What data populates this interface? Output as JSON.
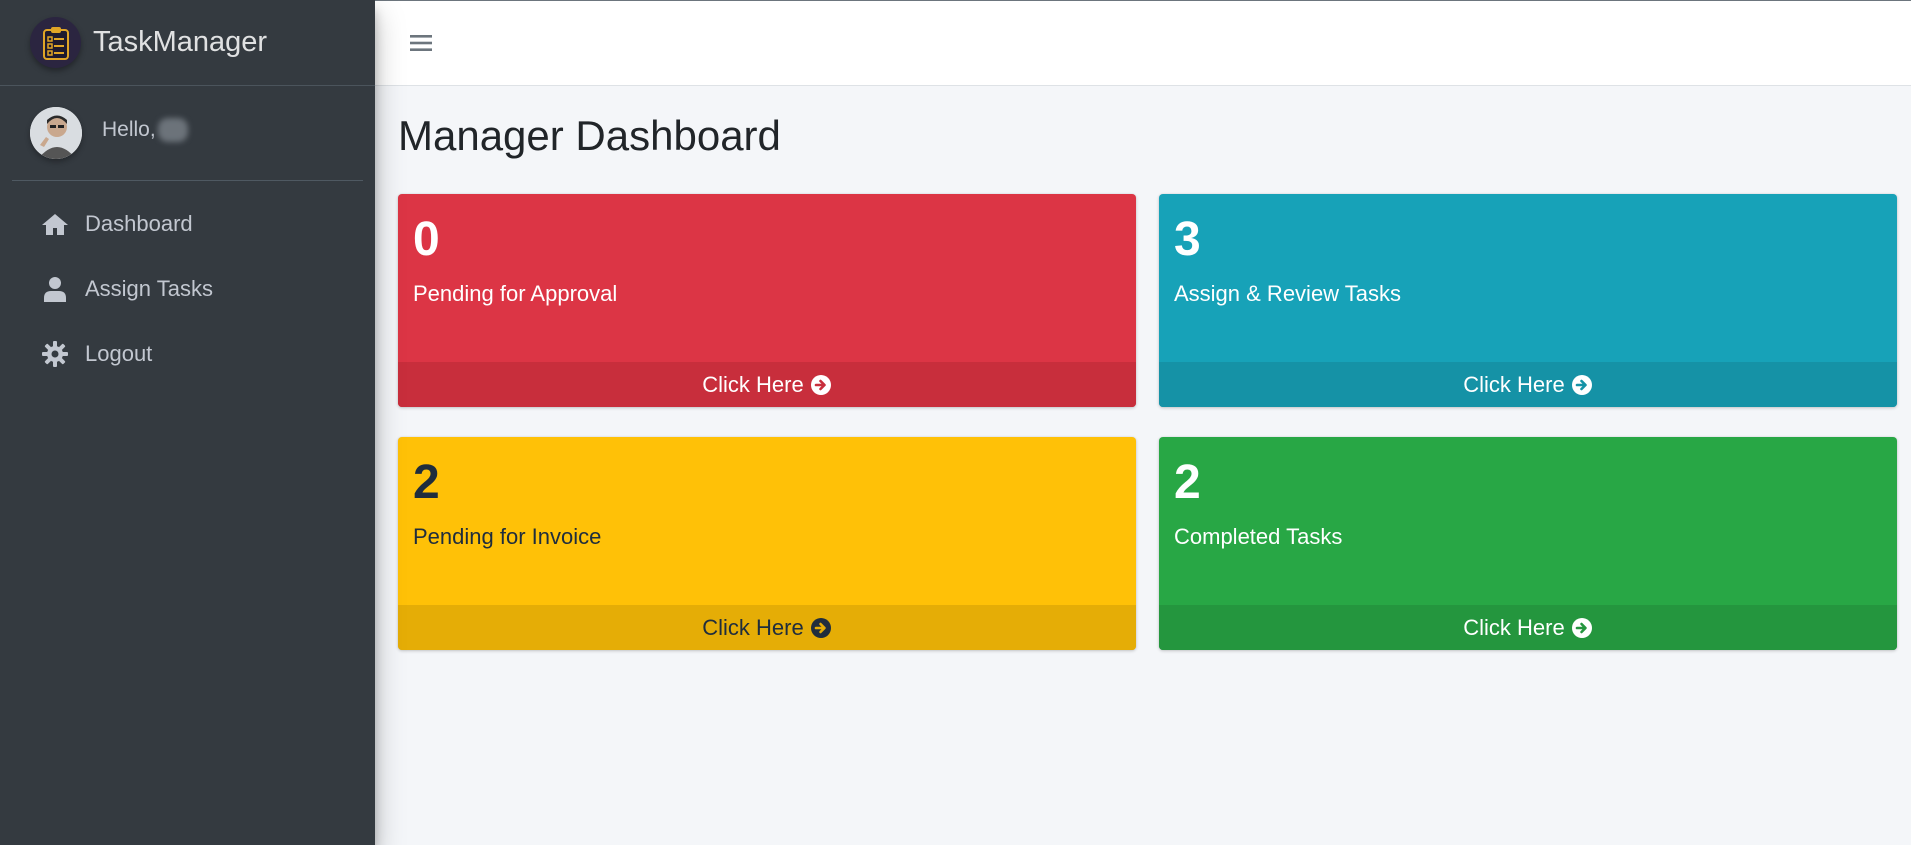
{
  "brand": {
    "name": "TaskManager"
  },
  "user": {
    "greeting": "Hello,"
  },
  "sidebar": {
    "items": [
      {
        "label": "Dashboard",
        "icon": "home-icon"
      },
      {
        "label": "Assign Tasks",
        "icon": "user-icon"
      },
      {
        "label": "Logout",
        "icon": "gear-icon"
      }
    ]
  },
  "main": {
    "title": "Manager Dashboard",
    "boxes": [
      {
        "count": "0",
        "label": "Pending for Approval",
        "footer": "Click Here",
        "color": "#dc3545"
      },
      {
        "count": "3",
        "label": "Assign & Review Tasks",
        "footer": "Click Here",
        "color": "#17a2b8"
      },
      {
        "count": "2",
        "label": "Pending for Invoice",
        "footer": "Click Here",
        "color": "#ffc107"
      },
      {
        "count": "2",
        "label": "Completed Tasks",
        "footer": "Click Here",
        "color": "#28a745"
      }
    ]
  }
}
